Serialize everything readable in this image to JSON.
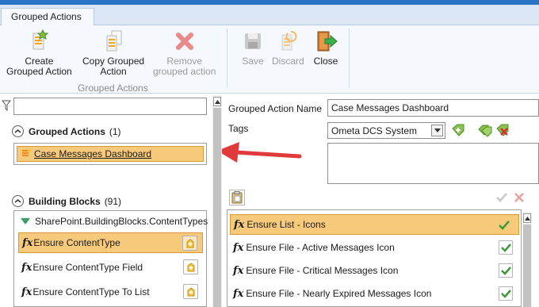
{
  "tab": {
    "label": "Grouped Actions"
  },
  "ribbon": {
    "group_label": "Grouped Actions",
    "create": {
      "line1": "Create",
      "line2": "Grouped Action"
    },
    "copy": {
      "line1": "Copy Grouped",
      "line2": "Action"
    },
    "remove": {
      "line1": "Remove",
      "line2": "grouped action"
    },
    "save": "Save",
    "discard": "Discard",
    "close": "Close"
  },
  "left": {
    "grouped_section": {
      "title": "Grouped Actions",
      "count": "(1)"
    },
    "grouped_items": [
      "Case Messages Dashboard"
    ],
    "blocks_section": {
      "title": "Building Blocks",
      "count": "(91)"
    },
    "blocks_category": "SharePoint.BuildingBlocks.ContentTypes",
    "blocks": [
      "Ensure ContentType",
      "Ensure ContentType Field",
      "Ensure ContentType To List"
    ]
  },
  "right": {
    "name_label": "Grouped Action Name",
    "name_value": "Case Messages Dashboard",
    "tags_label": "Tags",
    "tag_selected": "Ometa DCS System",
    "actions": [
      "Ensure List - Icons",
      "Ensure File - Active Messages Icon",
      "Ensure File - Critical Messages Icon",
      "Ensure File - Nearly Expired Messages Icon"
    ]
  },
  "colors": {
    "accent": "#2b73c4",
    "selection": "#f7c97b",
    "arrow": "#e03a3a"
  },
  "icons": [
    "plus-star-icon",
    "copy-icon",
    "remove-x-icon",
    "save-disk-icon",
    "discard-icon",
    "close-door-icon",
    "filter-icon",
    "grouped-action-icon",
    "fx-icon",
    "check-icon"
  ]
}
